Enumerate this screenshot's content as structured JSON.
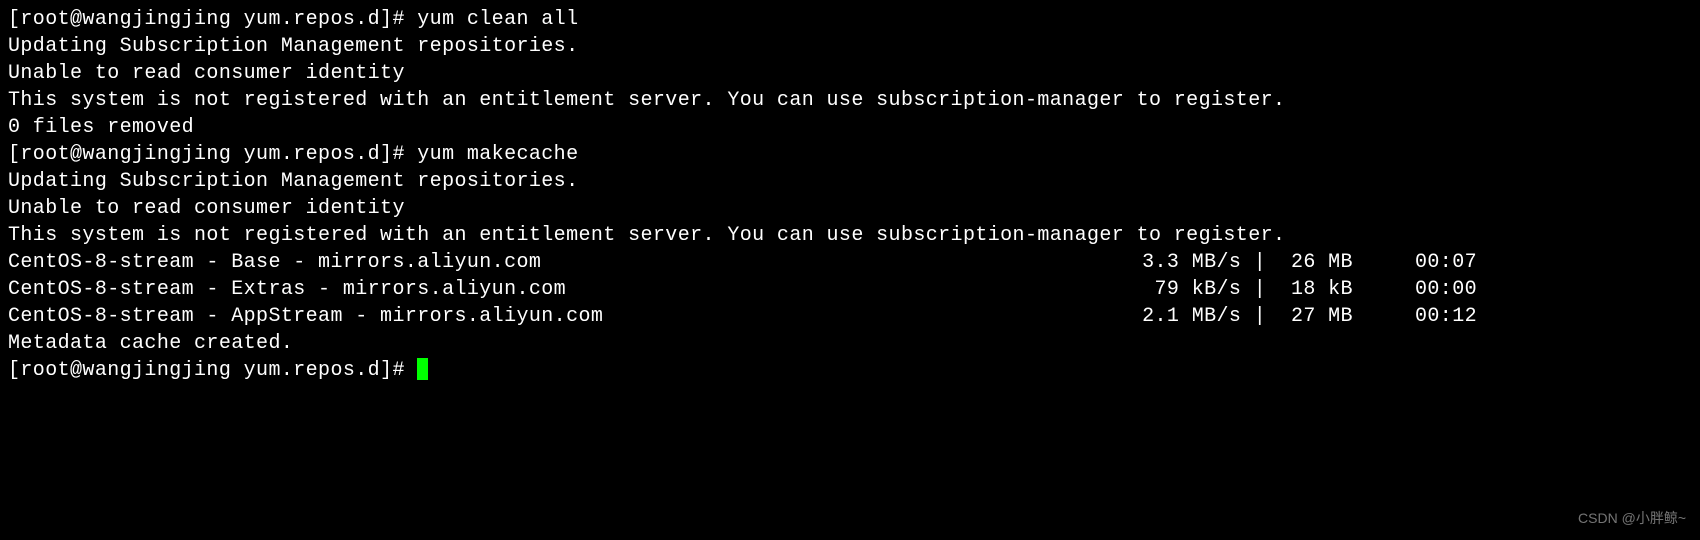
{
  "terminal": {
    "prompt1": "[root@wangjingjing yum.repos.d]# ",
    "cmd1": "yum clean all",
    "out1_line1": "Updating Subscription Management repositories.",
    "out1_line2": "Unable to read consumer identity",
    "blank": "",
    "out1_line3": "This system is not registered with an entitlement server. You can use subscription-manager to register.",
    "out1_line4": "0 files removed",
    "prompt2": "[root@wangjingjing yum.repos.d]# ",
    "cmd2": "yum makecache",
    "out2_line1": "Updating Subscription Management repositories.",
    "out2_line2": "Unable to read consumer identity",
    "out2_line3": "This system is not registered with an entitlement server. You can use subscription-manager to register.",
    "repos": [
      {
        "name": "CentOS-8-stream - Base - mirrors.aliyun.com",
        "speed": "3.3 MB/s",
        "size": " 26 MB",
        "time": "00:07"
      },
      {
        "name": "CentOS-8-stream - Extras - mirrors.aliyun.com",
        "speed": " 79 kB/s",
        "size": " 18 kB",
        "time": "00:00"
      },
      {
        "name": "CentOS-8-stream - AppStream - mirrors.aliyun.com",
        "speed": "2.1 MB/s",
        "size": " 27 MB",
        "time": "00:12"
      }
    ],
    "out2_line4": "Metadata cache created.",
    "prompt3": "[root@wangjingjing yum.repos.d]# "
  },
  "watermark": "CSDN @小胖鲸~"
}
